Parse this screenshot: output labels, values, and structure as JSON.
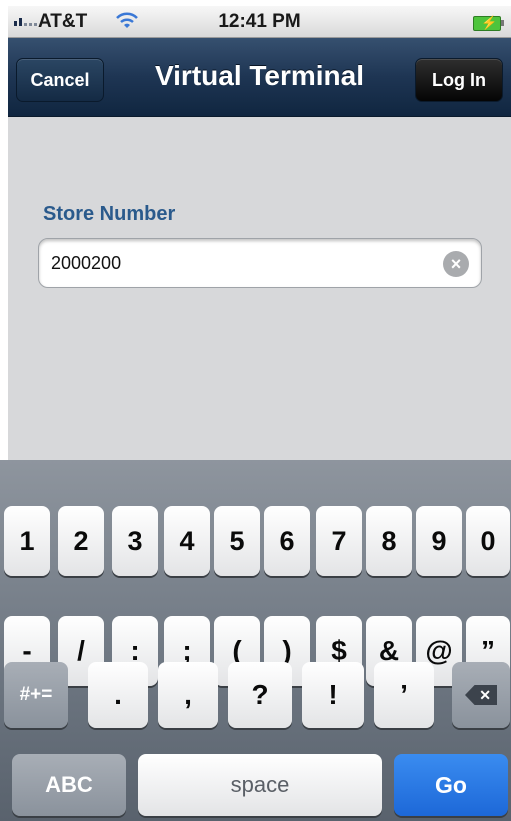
{
  "status_bar": {
    "carrier": "AT&T",
    "time": "12:41 PM",
    "signal_icon": "signal-bars-icon",
    "wifi_icon": "wifi-icon",
    "battery_icon": "battery-charging-icon"
  },
  "nav": {
    "title": "Virtual Terminal",
    "cancel_label": "Cancel",
    "login_label": "Log In"
  },
  "form": {
    "store_label": "Store Number",
    "store_value": "2000200",
    "clear_icon": "clear-icon"
  },
  "keyboard": {
    "row1": [
      "1",
      "2",
      "3",
      "4",
      "5",
      "6",
      "7",
      "8",
      "9",
      "0"
    ],
    "row2": [
      "-",
      "/",
      ":",
      ";",
      "(",
      ")",
      "$",
      "&",
      "@",
      "”"
    ],
    "row3": {
      "shift_label": "#+=",
      "keys": [
        ".",
        ",",
        "?",
        "!",
        "’"
      ],
      "backspace_icon": "backspace-icon"
    },
    "row4": {
      "abc_label": "ABC",
      "space_label": "space",
      "go_label": "Go"
    }
  },
  "colors": {
    "navbar": "#1e3553",
    "label_blue": "#2a5a8c",
    "go_key": "#1d68d8",
    "background": "#d7d8da"
  }
}
